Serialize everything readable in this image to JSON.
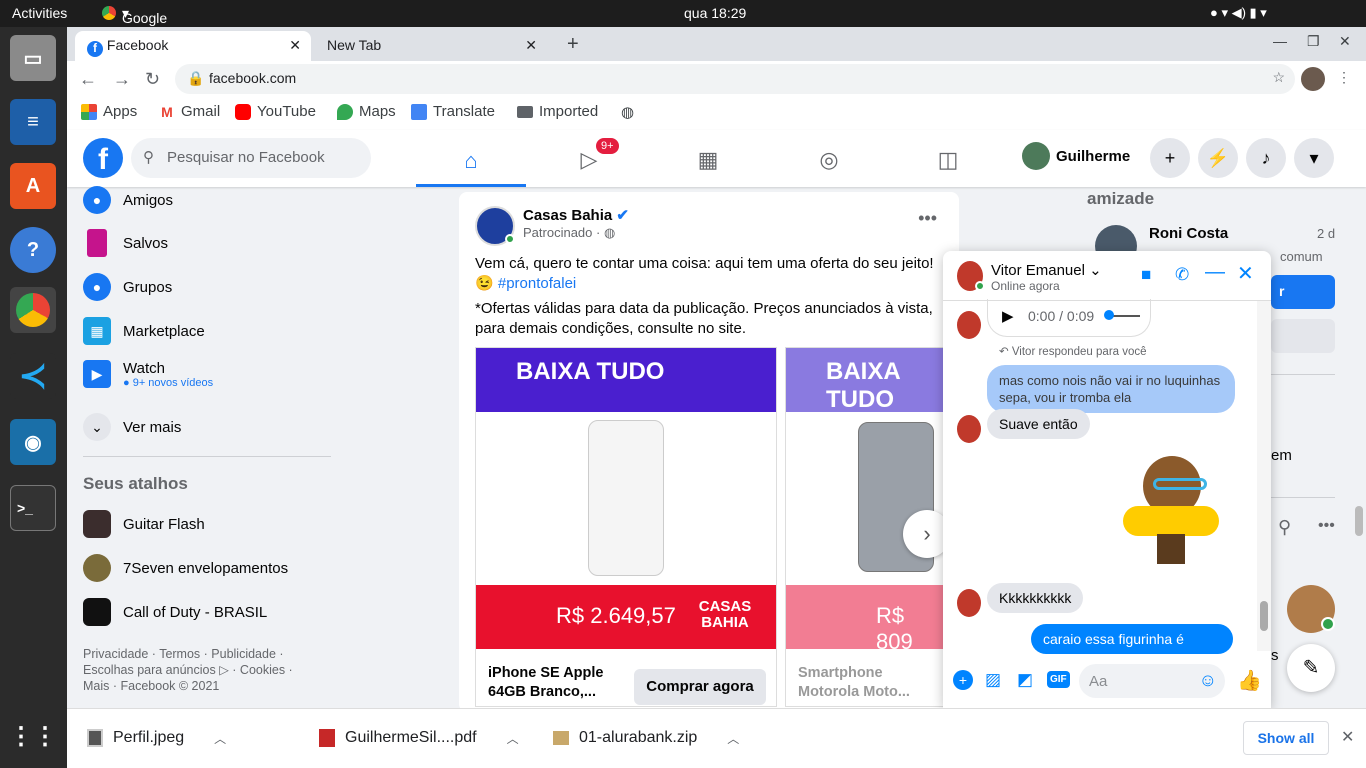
{
  "os": {
    "activities": "Activities",
    "app": "Google Chrome",
    "clock": "qua 18:29"
  },
  "browser": {
    "tabs": [
      {
        "label": "Facebook",
        "active": true
      },
      {
        "label": "New Tab",
        "active": false
      }
    ],
    "url": "facebook.com",
    "bookmarks": [
      "Apps",
      "Gmail",
      "YouTube",
      "Maps",
      "Translate",
      "Imported"
    ]
  },
  "fb": {
    "search_placeholder": "Pesquisar no Facebook",
    "watch_badge": "9+",
    "user_name": "Guilherme",
    "sidebar": {
      "items": [
        {
          "label": "Amigos"
        },
        {
          "label": "Salvos"
        },
        {
          "label": "Grupos"
        },
        {
          "label": "Marketplace"
        },
        {
          "label": "Watch",
          "sub": "9+ novos vídeos"
        },
        {
          "label": "Ver mais"
        }
      ],
      "shortcuts_title": "Seus atalhos",
      "shortcuts": [
        "Guitar Flash",
        "7Seven envelopamentos",
        "Call of Duty - BRASIL"
      ],
      "footer": "Privacidade · Termos · Publicidade · Escolhas para anúncios ▷ · Cookies · Mais · Facebook © 2021"
    },
    "post": {
      "author": "Casas Bahia",
      "sponsored": "Patrocinado",
      "text1": "Vem cá, quero te contar uma coisa: aqui tem uma oferta do seu jeito!",
      "hashtag": "#prontofalei",
      "text2": "*Ofertas válidas para data da publicação. Preços anunciados à vista, para demais condições, consulte no site.",
      "promo": "BAIXA TUDO",
      "cards": [
        {
          "price": "R$ 2.649,57",
          "brand": "CASAS BAHIA",
          "title": "iPhone SE Apple 64GB Branco,...",
          "cta": "Comprar agora"
        },
        {
          "price": "R$ 809",
          "title": "Smartphone Motorola Moto..."
        }
      ]
    },
    "right": {
      "section": "amizade",
      "friend": "Roni Costa",
      "time": "2 d",
      "mutual": "comum",
      "fragment": "em",
      "s": "s"
    },
    "chat": {
      "name": "Vitor Emanuel",
      "status": "Online agora",
      "audio_time": "0:00 / 0:09",
      "reply_note": "Vitor respondeu para você",
      "messages": [
        {
          "text": "mas como nois não vai ir no luquinhas sepa, vou ir tromba ela",
          "dir": "out"
        },
        {
          "text": "Suave então",
          "dir": "in"
        },
        {
          "text": "Kkkkkkkkkk",
          "dir": "in"
        },
        {
          "text": "caraio essa figurinha é",
          "dir": "out"
        }
      ],
      "input_placeholder": "Aa",
      "gif": "GIF"
    }
  },
  "downloads": {
    "items": [
      "Perfil.jpeg",
      "GuilhermeSil....pdf",
      "01-alurabank.zip"
    ],
    "show_all": "Show all"
  }
}
